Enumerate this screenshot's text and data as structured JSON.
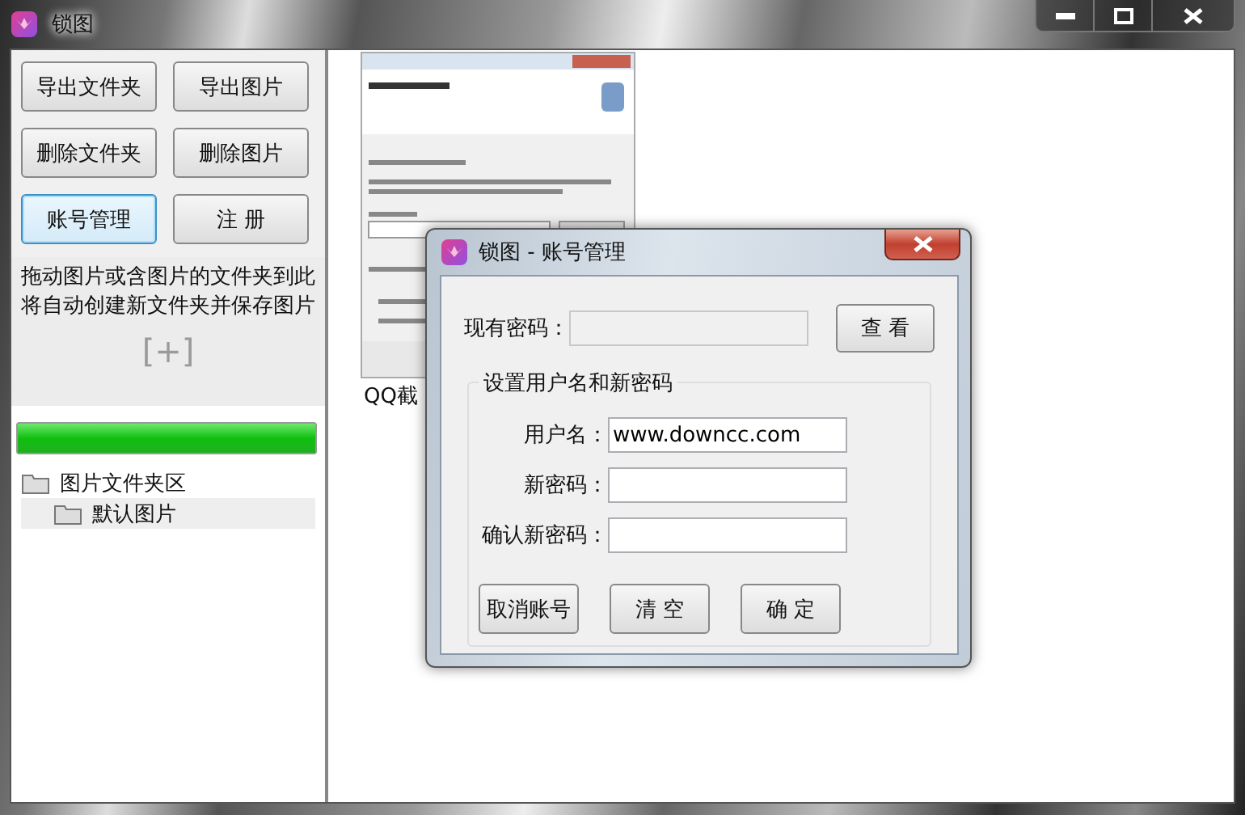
{
  "window": {
    "title": "锁图"
  },
  "left_panel": {
    "buttons": [
      {
        "label": "导出文件夹",
        "focused": false
      },
      {
        "label": "导出图片",
        "focused": false
      },
      {
        "label": "删除文件夹",
        "focused": false
      },
      {
        "label": "删除图片",
        "focused": false
      },
      {
        "label": "账号管理",
        "focused": true
      },
      {
        "label": "注 册",
        "focused": false
      }
    ],
    "drop_hint": [
      "拖动图片或含图片的文件夹到此",
      "将自动创建新文件夹并保存图片"
    ],
    "drop_icon": "[+]",
    "progress": {
      "level": 1
    },
    "tree": [
      {
        "label": "图片文件夹区",
        "selected": false,
        "children": [
          {
            "label": "默认图片",
            "selected": true
          }
        ]
      }
    ]
  },
  "gallery": {
    "items": [
      {
        "kind": "screenshot",
        "caption": "QQ截"
      }
    ]
  },
  "dialog": {
    "title": "锁图 - 账号管理",
    "current_password": {
      "label": "现有密码：",
      "disabled": true
    },
    "view_button": "查 看",
    "group": {
      "title": "设置用户名和新密码",
      "fields": [
        {
          "label": "用户名：",
          "value": "www.downcc.com"
        },
        {
          "label": "新密码："
        },
        {
          "label": "确认新密码："
        }
      ]
    },
    "buttons": [
      "取消账号",
      "清 空",
      "确 定"
    ]
  }
}
